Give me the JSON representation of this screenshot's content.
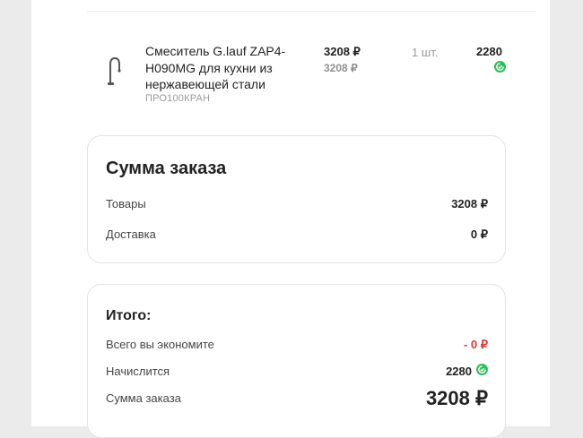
{
  "product": {
    "name": "Смеситель G.lauf ZAP4-H090MG для кухни из нержавеющей стали",
    "brand": "ПРО100КРАН",
    "price": "3208 ₽",
    "old_price": "3208 ₽",
    "quantity": "1 шт.",
    "bonus": "2280",
    "image_icon": "faucet-icon",
    "bonus_icon": "bonus-coin-icon"
  },
  "summary": {
    "title": "Сумма заказа",
    "items_label": "Товары",
    "items_value": "3208 ₽",
    "delivery_label": "Доставка",
    "delivery_value": "0 ₽"
  },
  "total": {
    "title": "Итого:",
    "savings_label": "Всего вы экономите",
    "savings_value": "- 0 ₽",
    "bonus_label": "Начислится",
    "bonus_value": "2280",
    "sum_label": "Сумма заказа",
    "sum_value": "3208 ₽"
  },
  "colors": {
    "bonus_green": "#2fbe5a",
    "savings_red": "#d93a3a",
    "background": "#ebebeb",
    "card_border": "#e3e3e3"
  }
}
